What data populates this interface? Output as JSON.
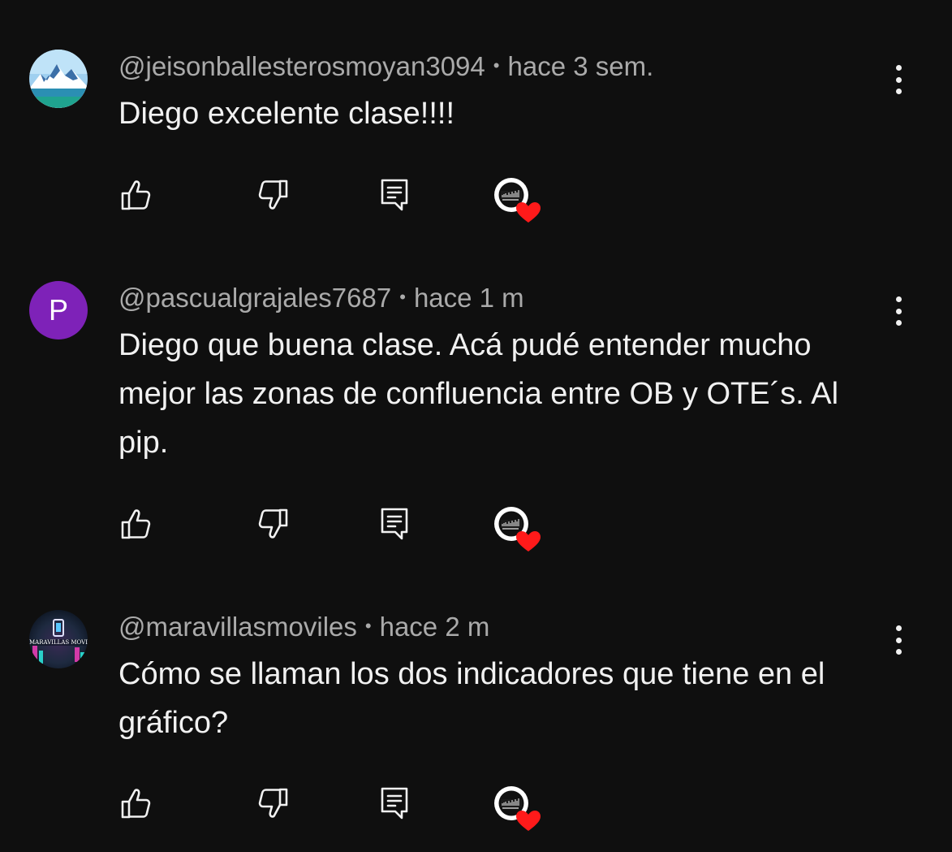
{
  "comments": [
    {
      "handle": "@jeisonballesterosmoyan3094",
      "separator": "•",
      "time": "hace 3 sem.",
      "text": "Diego excelente clase!!!!",
      "avatar_icon": "mountain-landscape-avatar"
    },
    {
      "handle": "@pascualgrajales7687",
      "separator": "•",
      "time": "hace 1 m",
      "text": "Diego que buena clase. Acá pudé entender mucho mejor las zonas de confluencia entre OB y OTE´s. Al pip.",
      "avatar_letter": "P",
      "avatar_color": "#7e22b8"
    },
    {
      "handle": "@maravillasmoviles",
      "separator": "•",
      "time": "hace 2 m",
      "text": "Cómo se llaman los dos indicadores que tiene en el gráfico?",
      "avatar_icon": "maravillas-moviles-logo-avatar",
      "avatar_logo_text": "MARAVILLAS MOVILES"
    }
  ],
  "colors": {
    "background": "#0f0f0f",
    "primary_text": "#f1f1f1",
    "secondary_text": "#aaaaaa",
    "heart": "#ff1a1a"
  },
  "icons": {
    "like": "thumbs-up-icon",
    "dislike": "thumbs-down-icon",
    "reply": "reply-comment-icon",
    "creator_heart": "creator-heart-icon",
    "menu": "more-vertical-icon"
  }
}
